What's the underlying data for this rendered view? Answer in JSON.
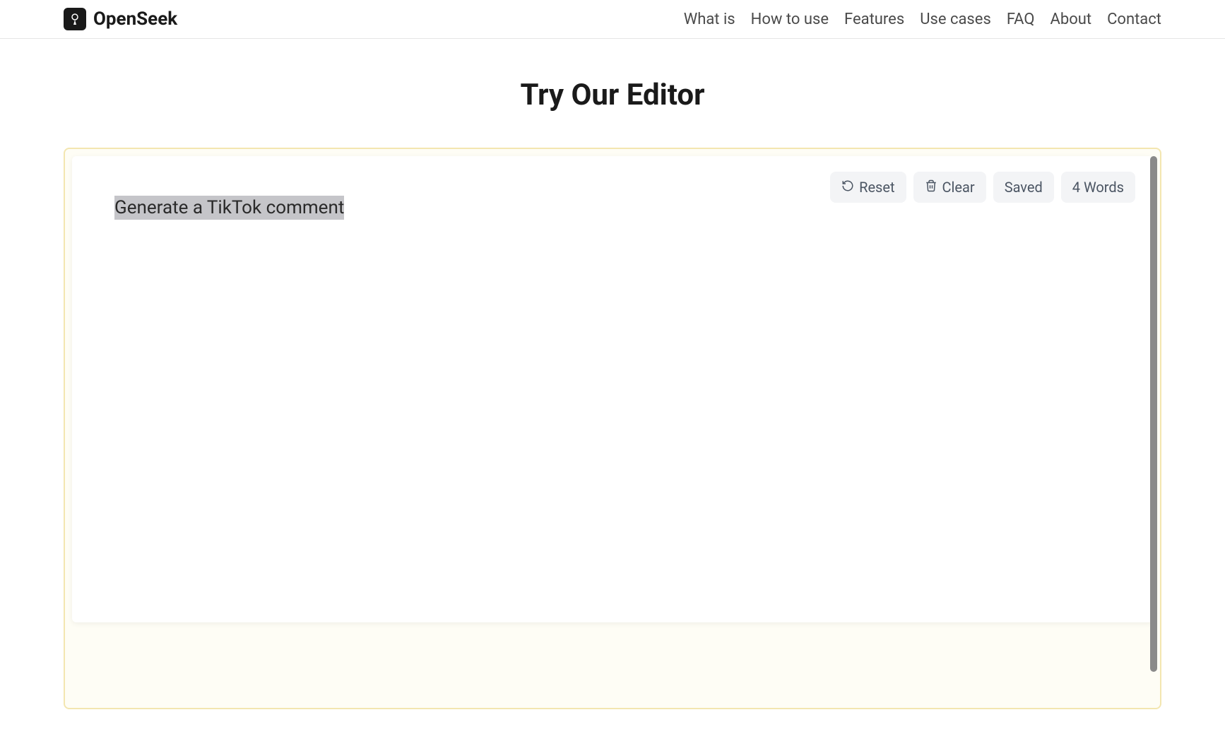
{
  "header": {
    "brand": "OpenSeek",
    "nav": [
      "What is",
      "How to use",
      "Features",
      "Use cases",
      "FAQ",
      "About",
      "Contact"
    ]
  },
  "main": {
    "title": "Try Our Editor"
  },
  "editor": {
    "content": "Generate a TikTok comment",
    "toolbar": {
      "reset_label": "Reset",
      "clear_label": "Clear"
    },
    "status": {
      "saved_label": "Saved",
      "word_count": "4 Words"
    }
  }
}
